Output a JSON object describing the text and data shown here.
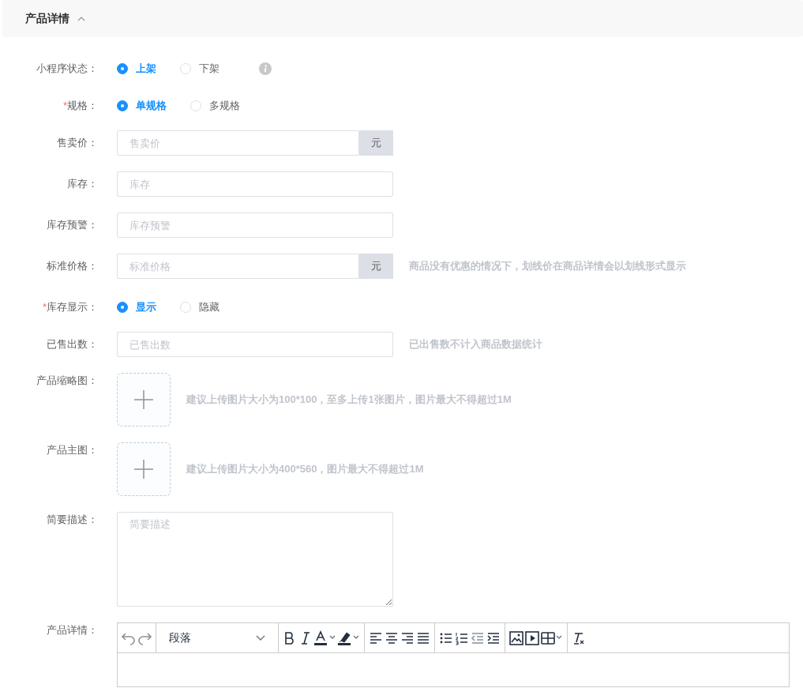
{
  "section": {
    "title": "产品详情",
    "expanded": true
  },
  "fields": [
    {
      "kind": "radio",
      "label": "小程序状态：",
      "info": true,
      "options": [
        {
          "label": "上架",
          "selected": true
        },
        {
          "label": "下架",
          "selected": false
        }
      ]
    },
    {
      "kind": "radio",
      "label": "规格：",
      "required_mark": "*",
      "options": [
        {
          "label": "单规格",
          "selected": true
        },
        {
          "label": "多规格",
          "selected": false
        }
      ]
    },
    {
      "kind": "input",
      "label": "售卖价：",
      "placeholder": "售卖价",
      "addon": "元"
    },
    {
      "kind": "input",
      "label": "库存：",
      "placeholder": "库存"
    },
    {
      "kind": "input",
      "label": "库存预警：",
      "placeholder": "库存预警"
    },
    {
      "kind": "input",
      "label": "标准价格：",
      "placeholder": "标准价格",
      "addon": "元",
      "hint": "商品没有优惠的情况下，划线价在商品详情会以划线形式显示"
    },
    {
      "kind": "radio",
      "label": "库存显示：",
      "required_mark": "*",
      "options": [
        {
          "label": "显示",
          "selected": true
        },
        {
          "label": "隐藏",
          "selected": false
        }
      ]
    },
    {
      "kind": "input",
      "label": "已售出数：",
      "placeholder": "已售出数",
      "hint": "已出售数不计入商品数据统计"
    },
    {
      "kind": "upload",
      "label": "产品缩略图：",
      "hint": "建议上传图片大小为100*100，至多上传1张图片，图片最大不得超过1M"
    },
    {
      "kind": "upload",
      "label": "产品主图：",
      "hint": "建议上传图片大小为400*560，图片最大不得超过1M"
    },
    {
      "kind": "textarea",
      "label": "简要描述：",
      "placeholder": "简要描述"
    },
    {
      "kind": "editor",
      "label": "产品详情：",
      "block_format": "段落"
    }
  ]
}
